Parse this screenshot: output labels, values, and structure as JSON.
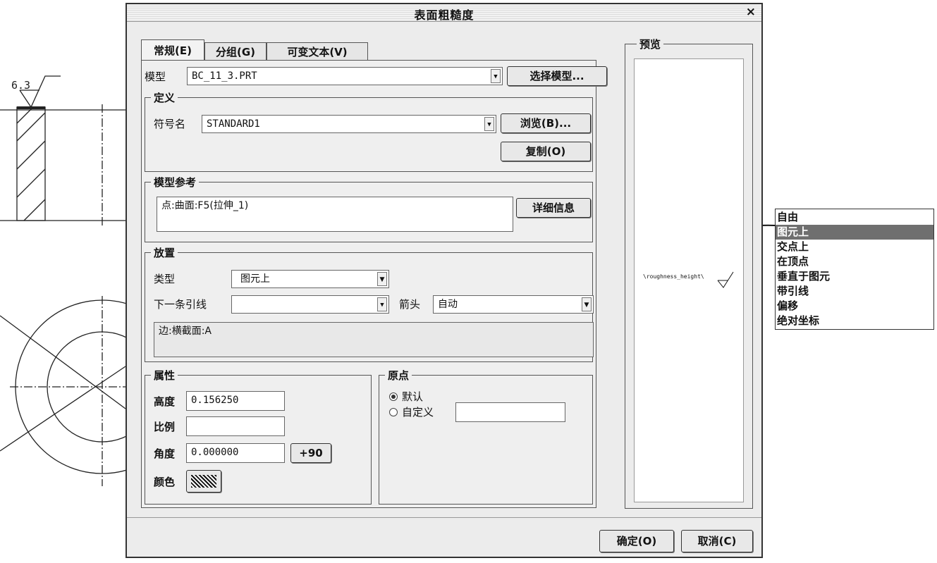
{
  "drawing": {
    "roughness_value": "6.3"
  },
  "dialog": {
    "title": "表面粗糙度",
    "close_glyph": "×",
    "tabs": [
      "常规(E)",
      "分组(G)",
      "可变文本(V)"
    ],
    "model_label": "模型",
    "model_value": "BC_11_3.PRT",
    "select_model_button": "选择模型...",
    "definition": {
      "legend": "定义",
      "symbol_name_label": "符号名",
      "symbol_name_value": "STANDARD1",
      "browse_button": "浏览(B)...",
      "copy_button": "复制(O)"
    },
    "model_reference": {
      "legend": "模型参考",
      "value": "点:曲面:F5(拉伸_1)",
      "details_button": "详细信息"
    },
    "placement": {
      "legend": "放置",
      "type_label": "类型",
      "type_value": "图元上",
      "next_leader_label": "下一条引线",
      "next_leader_value": "",
      "arrow_label": "箭头",
      "arrow_value": "自动",
      "reference_text": "边:横截面:A"
    },
    "attributes": {
      "legend": "属性",
      "height_label": "高度",
      "height_value": "0.156250",
      "scale_label": "比例",
      "scale_value": "",
      "angle_label": "角度",
      "angle_value": "0.000000",
      "plus90_button": "+90",
      "color_label": "颜色"
    },
    "origin": {
      "legend": "原点",
      "default_label": "默认",
      "custom_label": "自定义",
      "custom_value": "",
      "selected": "default"
    },
    "preview": {
      "legend": "预览",
      "symbol_text": "\\roughness_height\\"
    },
    "ok_button": "确定(O)",
    "cancel_button": "取消(C)"
  },
  "type_options": {
    "items": [
      "自由",
      "图元上",
      "交点上",
      "在顶点",
      "垂直于图元",
      "带引线",
      "偏移",
      "绝对坐标"
    ],
    "selected_index": 1
  }
}
